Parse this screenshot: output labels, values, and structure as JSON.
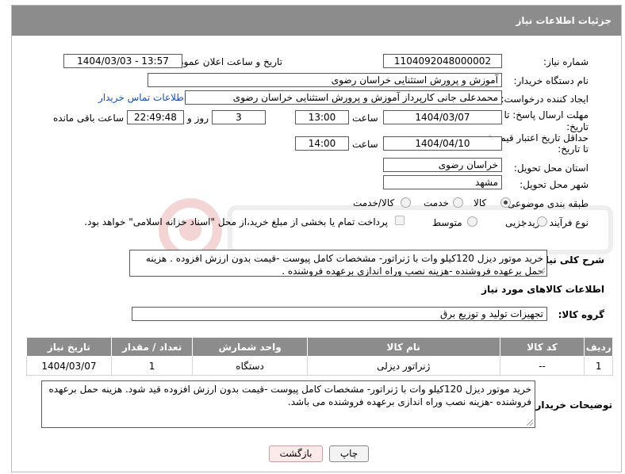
{
  "header": {
    "title": "جزئیات اطلاعات نیاز"
  },
  "fields": {
    "need_number_label": "شماره نیاز:",
    "need_number": "1104092048000002",
    "announce_label": "تاریخ و ساعت اعلان عمومی:",
    "announce_value": "1404/03/03 - 13:57",
    "buyer_org_label": "نام دستگاه خریدار:",
    "buyer_org": "آموزش و پرورش استثنایی خراسان رضوی",
    "creator_label": "ایجاد کننده درخواست:",
    "creator": "محمدعلی جانی کارپرداز آموزش و پرورش استثنایی خراسان رضوی",
    "contact_link": "اطلاعات تماس خریدار",
    "deadline_label_1": "مهلت ارسال پاسخ: تا",
    "deadline_label_2": "تاریخ:",
    "deadline_date": "1404/03/07",
    "time_label": "ساعت",
    "deadline_time": "13:00",
    "days_value": "3",
    "days_label": "روز و",
    "remaining_value": "22:49:48",
    "remaining_label": "ساعت باقی مانده",
    "validity_label_1": "حداقل تاریخ اعتبار قیمت:",
    "validity_label_2": "تا تاریخ:",
    "validity_date": "1404/04/10",
    "validity_time_label": "ساعت",
    "validity_time": "14:00",
    "province_label": "استان محل تحویل:",
    "province": "خراسان رضوی",
    "city_label": "شهر محل تحویل:",
    "city": "مشهد",
    "category_label": "طبقه بندی موضوعی:",
    "category_options": [
      "کالا",
      "خدمت",
      "کالا/خدمت"
    ],
    "process_label": "نوع فرآیند خرید :",
    "process_options": [
      "جزیی",
      "متوسط"
    ],
    "payment_note": "پرداخت تمام یا بخشی از مبلغ خرید،از محل \"اسناد خزانه اسلامی\" خواهد بود."
  },
  "description": {
    "label": "شرح کلی نیاز:",
    "text": "خرید موتور دیزل 120کیلو وات با ژنراتور- مشخصات کامل پیوست -قیمت بدون ارزش افزوده . هزینه حمل برعهده فروشنده -هزینه نصب وراه اندازی برعهده فروشنده ."
  },
  "goods_section": {
    "title": "اطلاعات کالاهای مورد نیاز",
    "group_label": "گروه کالا:",
    "group_value": "تجهیزات تولید و توزیع برق",
    "columns": [
      "ردیف",
      "کد کالا",
      "نام کالا",
      "واحد شمارش",
      "تعداد / مقدار",
      "تاریخ نیاز"
    ],
    "rows": [
      [
        "1",
        "--",
        "ژنراتور دیزلی",
        "دستگاه",
        "1",
        "1404/03/07"
      ]
    ]
  },
  "buyer_notes": {
    "label": "توضیحات خریدار:",
    "text": "خرید موتور دیزل 120کیلو وات با ژنراتور- مشخصات کامل پیوست -قیمت بدون ارزش افزوده قید شود. هزینه حمل برعهده فروشنده -هزینه نصب وراه اندازی برعهده فروشنده می باشد."
  },
  "buttons": {
    "print": "چاپ",
    "back": "بازگشت"
  },
  "colors": {
    "header_bg": "#8c8c8c",
    "link": "#1a4dae",
    "back_button_bg": "#fde8ea"
  }
}
